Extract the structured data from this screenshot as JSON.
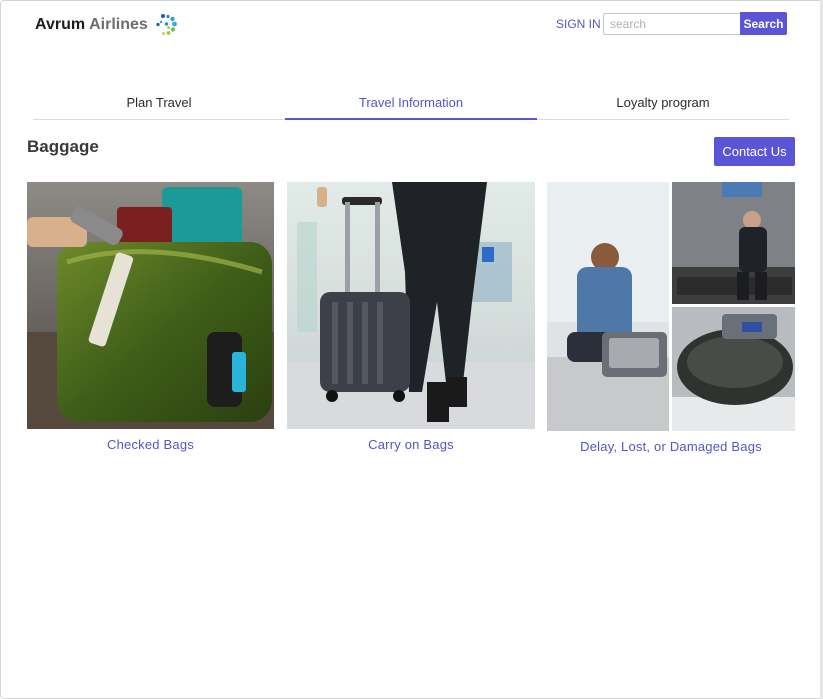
{
  "brand": {
    "name_part1": "Avrum",
    "name_part2": "Airlines",
    "logo_icon": "swirl-dots-logo-icon"
  },
  "header": {
    "signin_label": "SIGN IN",
    "search_placeholder": "search",
    "search_value": "",
    "search_button": "Search"
  },
  "tabs": [
    {
      "label": "Plan Travel",
      "active": false
    },
    {
      "label": "Travel Information",
      "active": true
    },
    {
      "label": "Loyalty program",
      "active": false
    }
  ],
  "page": {
    "title": "Baggage",
    "contact_button": "Contact Us"
  },
  "cards": [
    {
      "label": "Checked Bags",
      "image": "green-suitcase-photo"
    },
    {
      "label": "Carry on Bags",
      "image": "rolling-carry-on-photo"
    },
    {
      "label": "Delay, Lost, or Damaged Bags",
      "image": "damaged-luggage-collage-photo"
    }
  ],
  "colors": {
    "accent": "#5a55d6",
    "link": "#5455c8"
  }
}
